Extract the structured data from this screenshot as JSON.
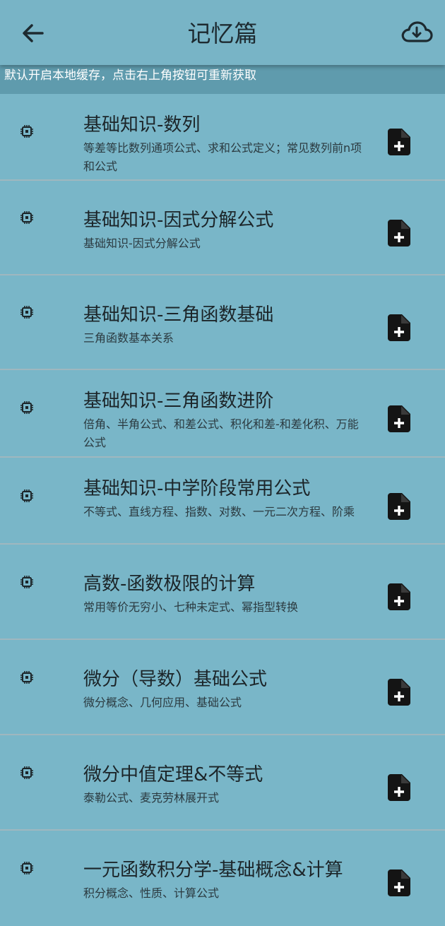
{
  "header": {
    "title": "记忆篇"
  },
  "notice": "默认开启本地缓存，点击右上角按钮可重新获取",
  "icons": {
    "back": "arrow-left-icon",
    "download": "cloud-download-icon",
    "item": "chip-icon",
    "add": "file-plus-icon"
  },
  "colors": {
    "background": "#79b6c8",
    "notice_bg": "#5f9bad"
  },
  "items": [
    {
      "title": "基础知识-数列",
      "subtitle": "等差等比数列通项公式、求和公式定义；常见数列前n项和公式"
    },
    {
      "title": "基础知识-因式分解公式",
      "subtitle": "基础知识-因式分解公式"
    },
    {
      "title": "基础知识-三角函数基础",
      "subtitle": "三角函数基本关系"
    },
    {
      "title": "基础知识-三角函数进阶",
      "subtitle": "倍角、半角公式、和差公式、积化和差-和差化积、万能公式"
    },
    {
      "title": "基础知识-中学阶段常用公式",
      "subtitle": "不等式、直线方程、指数、对数、一元二次方程、阶乘"
    },
    {
      "title": "高数-函数极限的计算",
      "subtitle": "常用等价无穷小、七种未定式、幂指型转换"
    },
    {
      "title": "微分（导数）基础公式",
      "subtitle": "微分概念、几何应用、基础公式"
    },
    {
      "title": "微分中值定理&不等式",
      "subtitle": "泰勒公式、麦克劳林展开式"
    },
    {
      "title": "一元函数积分学-基础概念&计算",
      "subtitle": "积分概念、性质、计算公式"
    }
  ]
}
